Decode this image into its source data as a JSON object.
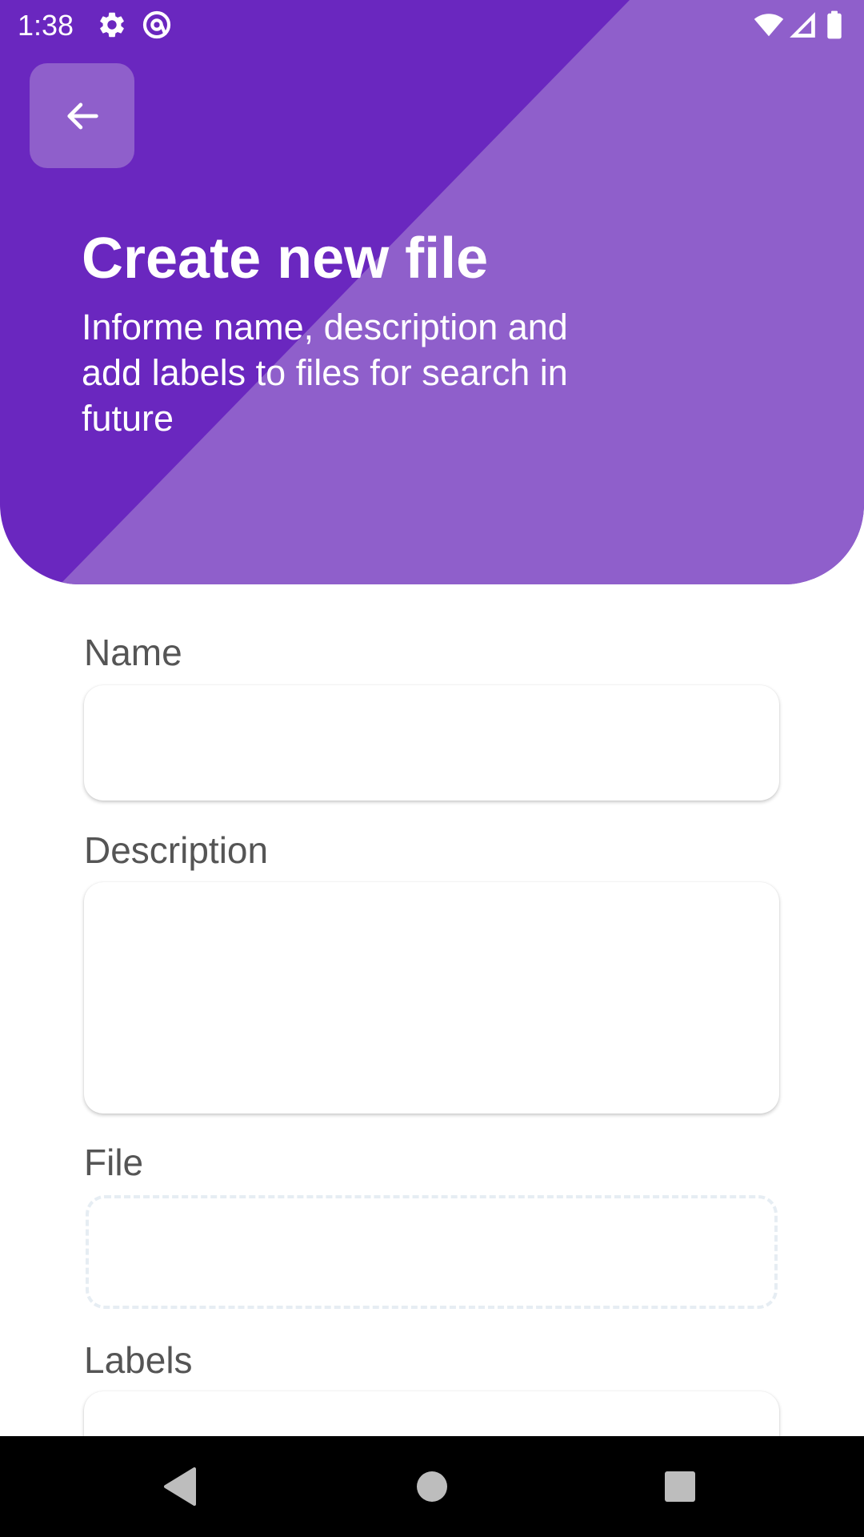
{
  "status_bar": {
    "time": "1:38",
    "icons": [
      "gear-icon",
      "at-sign-icon",
      "wifi-icon",
      "signal-icon",
      "battery-icon"
    ]
  },
  "header": {
    "back_icon": "arrow-left-icon",
    "title": "Create new file",
    "subtitle": "Informe name, description and add labels to files for search in future",
    "colors": {
      "primary": "#6a27bf",
      "secondary": "#8f5fcb"
    }
  },
  "form": {
    "name": {
      "label": "Name",
      "value": ""
    },
    "description": {
      "label": "Description",
      "value": ""
    },
    "file": {
      "label": "File"
    },
    "labels": {
      "label": "Labels",
      "value": ""
    }
  },
  "nav_bar": {
    "icons": [
      "back-triangle-icon",
      "home-circle-icon",
      "recents-square-icon"
    ]
  }
}
